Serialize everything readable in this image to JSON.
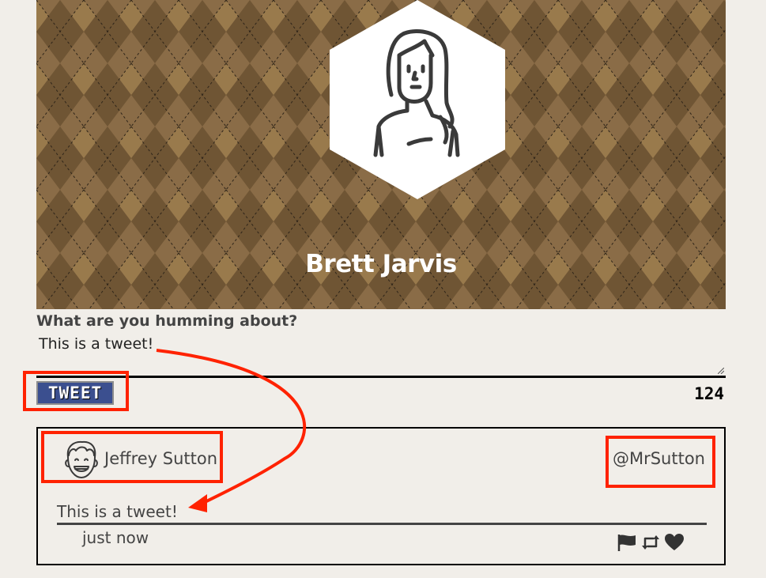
{
  "profile": {
    "name": "Brett Jarvis",
    "avatar_icon": "woman-avatar-icon"
  },
  "composer": {
    "label": "What are you humming about?",
    "value": "This is a tweet!",
    "tweet_button_label": "TWEET",
    "char_count": "124"
  },
  "tweet": {
    "author_name": "Jeffrey Sutton",
    "handle": "@MrSutton",
    "text": "This is a tweet!",
    "timestamp": "just now",
    "avatar_icon": "man-avatar-icon",
    "actions": [
      "flag-icon",
      "retweet-icon",
      "heart-icon"
    ]
  },
  "colors": {
    "background": "#f1eee9",
    "banner_base": "#8a6a44",
    "button_blue": "#3b4f8f",
    "annotation_red": "#ff2200"
  }
}
